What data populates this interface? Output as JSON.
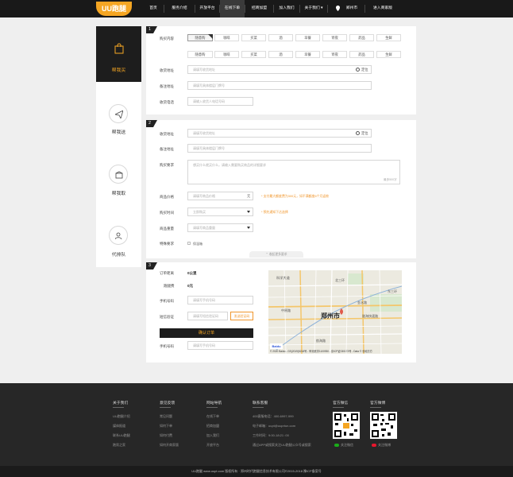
{
  "brand": {
    "logo": "UU跑腿"
  },
  "nav": {
    "items": [
      "首页",
      "服务介绍",
      "开放平台",
      "在线下单",
      "招商加盟",
      "加入我们",
      "关于我们 ▾"
    ],
    "city": "郑州市",
    "merchant": "进入商家版"
  },
  "sidebar": {
    "items": [
      "帮我买",
      "帮我送",
      "帮我取",
      "代排队"
    ]
  },
  "step1": {
    "num": "1",
    "labels": [
      "购买内容",
      "收货地址",
      "备注地址",
      "收货电话"
    ],
    "tags": [
      "随意购",
      "咖啡",
      "买菜",
      "酒",
      "早餐",
      "宵夜",
      "药品",
      "生鲜"
    ],
    "address_ph": "请填写收货地址",
    "locate": "定位",
    "remark_ph": "请填写具体楼层门牌号",
    "phone_ph": "请输入收货人电话号码"
  },
  "step2": {
    "num": "2",
    "labels": [
      "收货地址",
      "备注地址",
      "购买要求",
      "商品价格",
      "购买时间",
      "商品重量",
      "特殊要求"
    ],
    "address_ph": "请填写收货地址",
    "locate": "定位",
    "remark_ph": "请填写具体楼层门牌号",
    "req_ph": "想买什么就买什么，请输入需要购买商品的详细要求",
    "req_count": "最多500字",
    "price_ph": "请填写商品价格",
    "price_unit": "元",
    "price_note": "* 支付最大额度费为300元，如不满额度6个月返款",
    "time_ph": "立即购买",
    "time_note": "* 预先通知下达选择",
    "weight_ph": "请填写商品重量",
    "special": "保温箱",
    "more": "⌃ 收起更多要求"
  },
  "step3": {
    "num": "3",
    "fee_label": "订单距离",
    "fee_value": "0公里",
    "price_label": "跑腿费",
    "price_value": "0元",
    "phone_label": "手机号码",
    "phone_ph": "请填写手机号码",
    "code_label": "短信验证",
    "code_ph": "请填写短信验证码",
    "code_btn": "发送验证码",
    "submit": "确认订单",
    "phone2_label": "手机号码",
    "phone2_ph": "请填写手机号码"
  },
  "map": {
    "city_label": "郑州市",
    "places": [
      "科学大道",
      "中原路",
      "金水路",
      "陇海快速路",
      "航海路",
      "北三环",
      "东三环"
    ],
    "copyright": "© 2020 Baidu - GS(2019)5218号 - 甲测资字1100930 - 京ICP证030173号 - Data © 长地万方"
  },
  "footer": {
    "cols": [
      {
        "title": "关于我们",
        "links": [
          "UU跑腿介绍",
          "媒体报道",
          "联系UU跑腿",
          "跑男之家"
        ]
      },
      {
        "title": "意见反馈",
        "links": [
          "常见问题",
          "如何下单",
          "如何付费",
          "如何开商家版"
        ]
      },
      {
        "title": "网站导航",
        "links": [
          "在线下单",
          "招商加盟",
          "加入我们",
          "开放平台"
        ]
      },
      {
        "title": "联系客服",
        "links": [
          "400客服电话：400-6997-999",
          "电子邮箱：uupt@uuprtun.com",
          "工作时间：9:00-18:21 :00",
          "通过APP或搜索关注UU跑腿公众号或搜索"
        ]
      }
    ],
    "wechat_title": "官方微信",
    "weibo_title": "官方微博",
    "wechat_link": "关注微信",
    "weibo_link": "关注微博",
    "copyright": "UU跑腿 www.uupt.com 版权所有 · 郑州时代跑腿信息技术有限公司©2015-2018 豫ICP备案号"
  }
}
